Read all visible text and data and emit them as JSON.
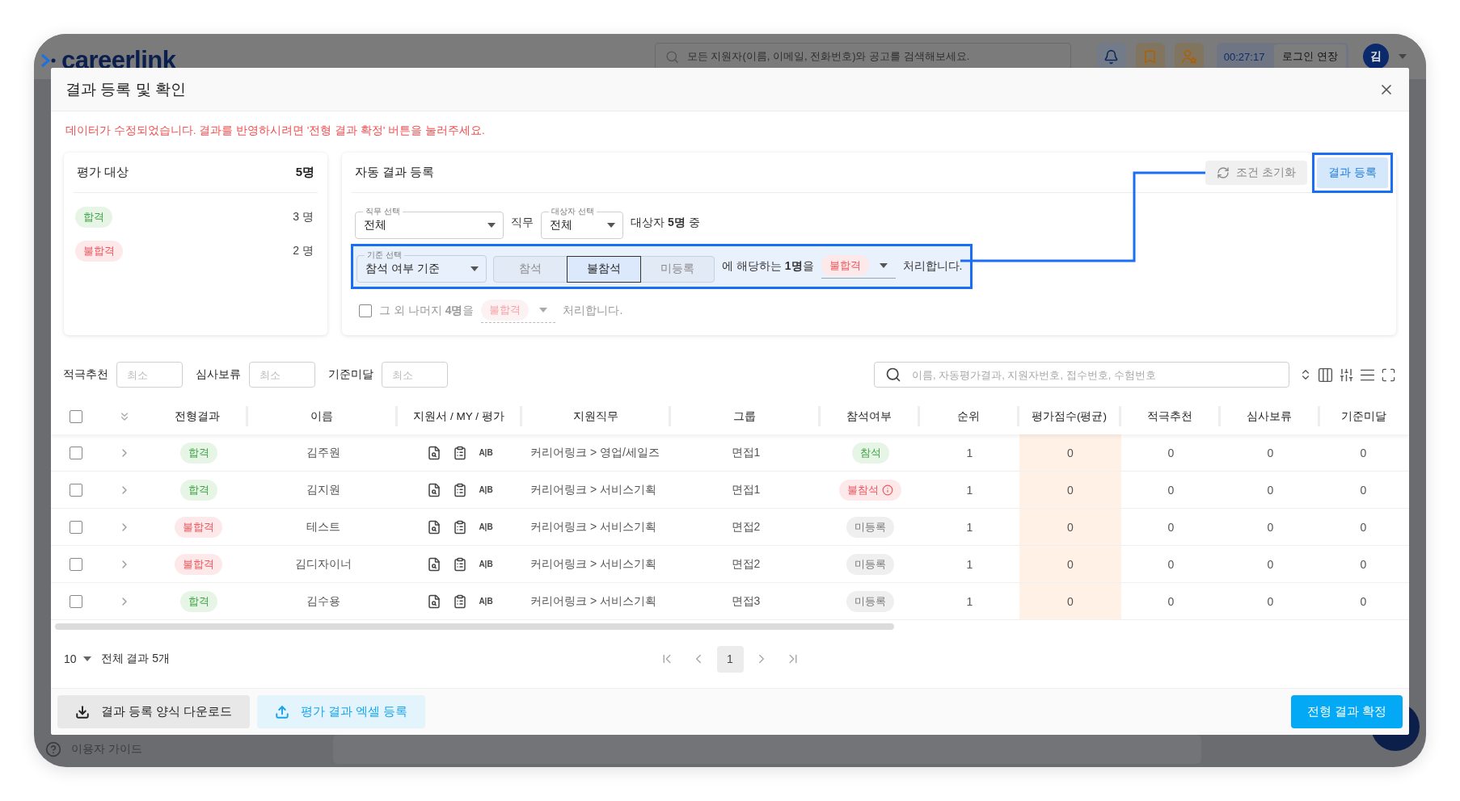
{
  "background_app": {
    "logo": "careerlink",
    "search_placeholder": "모든 지원자(이름, 이메일, 전화번호)와 공고를 검색해보세요.",
    "timer": "00:27:17",
    "extend_login": "로그인 연장",
    "avatar": "김",
    "guide_link": "이용자 가이드"
  },
  "modal": {
    "title": "결과 등록 및 확인",
    "notice": "데이터가 수정되었습니다. 결과를 반영하시려면 '전형 결과 확정' 버튼을 눌러주세요."
  },
  "summary": {
    "title": "평가 대상",
    "total": "5명",
    "rows": [
      {
        "label": "합격",
        "kind": "pass",
        "count": "3 명"
      },
      {
        "label": "불합격",
        "kind": "fail",
        "count": "2 명"
      }
    ]
  },
  "auto": {
    "title": "자동 결과 등록",
    "reset_button": "조건 초기화",
    "register_button": "결과 등록",
    "job_select": {
      "label": "직무 선택",
      "value": "전체"
    },
    "job_suffix": "직무",
    "target_select": {
      "label": "대상자 선택",
      "value": "전체"
    },
    "target_text": "대상자 **5명** 중",
    "criteria_select": {
      "label": "기준 선택",
      "value": "참석 여부 기준"
    },
    "options": [
      {
        "label": "참석",
        "selected": false
      },
      {
        "label": "불참석",
        "selected": true
      },
      {
        "label": "미등록",
        "selected": false
      }
    ],
    "match_text": "에 해당하는 **1명**을",
    "match_result": {
      "label": "불합격",
      "kind": "fail"
    },
    "match_suffix": "처리합니다.",
    "rest": {
      "checked": false,
      "text": "그 외 나머지 **4명**을",
      "result": {
        "label": "불합격",
        "kind": "fail"
      },
      "suffix": "처리합니다."
    }
  },
  "filters": [
    {
      "label": "적극추천",
      "placeholder": "최소"
    },
    {
      "label": "심사보류",
      "placeholder": "최소"
    },
    {
      "label": "기준미달",
      "placeholder": "최소"
    }
  ],
  "search_placeholder": "이름, 자동평가결과, 지원자번호, 접수번호, 수험번호",
  "table": {
    "all_checked": false,
    "columns": [
      "전형결과",
      "이름",
      "지원서 / MY / 평가",
      "지원직무",
      "그룹",
      "참석여부",
      "순위",
      "평가점수(평균)",
      "적극추천",
      "심사보류",
      "기준미달"
    ],
    "rows": [
      {
        "checked": false,
        "expanded": false,
        "result": {
          "label": "합격",
          "kind": "pass"
        },
        "name": "김주원",
        "eval": "A|B",
        "job": "커리어링크 > 영업/세일즈",
        "group": "면접1",
        "attendance": {
          "label": "참석",
          "kind": "present"
        },
        "rank": "1",
        "score": "0",
        "recommend": "0",
        "hold": "0",
        "below": "0"
      },
      {
        "checked": false,
        "expanded": false,
        "result": {
          "label": "합격",
          "kind": "pass"
        },
        "name": "김지원",
        "eval": "A|B",
        "job": "커리어링크 > 서비스기획",
        "group": "면접1",
        "attendance": {
          "label": "불참석",
          "kind": "absent"
        },
        "rank": "1",
        "score": "0",
        "recommend": "0",
        "hold": "0",
        "below": "0"
      },
      {
        "checked": false,
        "expanded": false,
        "result": {
          "label": "불합격",
          "kind": "fail"
        },
        "name": "테스트",
        "eval": "A|B",
        "job": "커리어링크 > 서비스기획",
        "group": "면접2",
        "attendance": {
          "label": "미등록",
          "kind": "unregistered"
        },
        "rank": "1",
        "score": "0",
        "recommend": "0",
        "hold": "0",
        "below": "0"
      },
      {
        "checked": false,
        "expanded": false,
        "result": {
          "label": "불합격",
          "kind": "fail"
        },
        "name": "김디자이너",
        "eval": "A|B",
        "job": "커리어링크 > 서비스기획",
        "group": "면접2",
        "attendance": {
          "label": "미등록",
          "kind": "unregistered"
        },
        "rank": "1",
        "score": "0",
        "recommend": "0",
        "hold": "0",
        "below": "0"
      },
      {
        "checked": false,
        "expanded": false,
        "result": {
          "label": "합격",
          "kind": "pass"
        },
        "name": "김수용",
        "eval": "A|B",
        "job": "커리어링크 > 서비스기획",
        "group": "면접3",
        "attendance": {
          "label": "미등록",
          "kind": "unregistered"
        },
        "rank": "1",
        "score": "0",
        "recommend": "0",
        "hold": "0",
        "below": "0"
      }
    ]
  },
  "pagination": {
    "page_size": "10",
    "total": "전체 결과 5개",
    "pages": [
      {
        "label": "1",
        "selected": true
      }
    ]
  },
  "footer": {
    "download_button": "결과 등록 양식 다운로드",
    "upload_button": "평가 결과 엑셀 등록",
    "confirm_button": "전형 결과 확정"
  }
}
